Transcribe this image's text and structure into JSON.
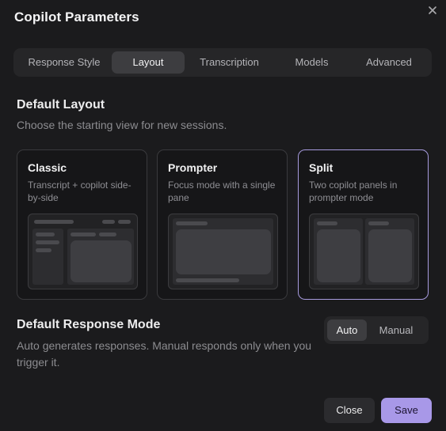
{
  "dialog": {
    "title": "Copilot Parameters"
  },
  "tabs": [
    {
      "label": "Response Style",
      "active": false
    },
    {
      "label": "Layout",
      "active": true
    },
    {
      "label": "Transcription",
      "active": false
    },
    {
      "label": "Models",
      "active": false
    },
    {
      "label": "Advanced",
      "active": false
    }
  ],
  "layout_section": {
    "title": "Default Layout",
    "description": "Choose the starting view for new sessions."
  },
  "layout_options": [
    {
      "title": "Classic",
      "description": "Transcript + copilot side-by-side",
      "selected": false
    },
    {
      "title": "Prompter",
      "description": "Focus mode with a single pane",
      "selected": false
    },
    {
      "title": "Split",
      "description": "Two copilot panels in prompter mode",
      "selected": true
    }
  ],
  "response_section": {
    "title": "Default Response Mode",
    "description": "Auto generates responses. Manual responds only when you trigger it."
  },
  "response_mode": {
    "options": [
      "Auto",
      "Manual"
    ],
    "selected": "Auto"
  },
  "footer": {
    "close_label": "Close",
    "save_label": "Save"
  },
  "colors": {
    "background": "#1b1b1d",
    "accent": "#a898e8",
    "selected_border": "#a79bde"
  },
  "icons": {
    "close": "close-icon"
  }
}
